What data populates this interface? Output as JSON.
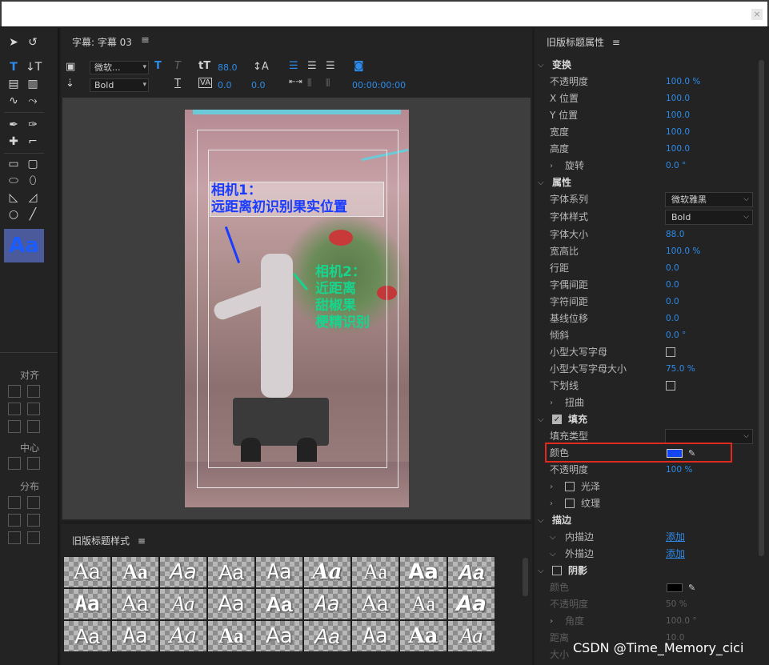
{
  "window": {
    "close_label": "×"
  },
  "editor": {
    "tab_title": "字幕: 字幕 03",
    "menu_icon": "≡",
    "font_family_short": "微软...",
    "font_style": "Bold",
    "font_size": "88.0",
    "kerning": "0.0",
    "leading": "0.0",
    "timecode": "00:00:00:00",
    "caption1_line1": "相机1：",
    "caption1_line2": "远距离初识别果实位置",
    "caption2_line1": "相机2：",
    "caption2_line2": "近距离",
    "caption2_line3": "甜椒果",
    "caption2_line4": "梗精识别"
  },
  "tools": {
    "aa_label": "Aa",
    "align_label": "对齐",
    "center_label": "中心",
    "distribute_label": "分布"
  },
  "styles_panel": {
    "title": "旧版标题样式",
    "menu_icon": "≡",
    "sample_label": "Aa"
  },
  "props": {
    "title": "旧版标题属性",
    "menu_icon": "≡",
    "transform": "变换",
    "opacity_label": "不透明度",
    "opacity_value": "100.0 %",
    "x_label": "X 位置",
    "x_value": "100.0",
    "y_label": "Y 位置",
    "y_value": "100.0",
    "width_label": "宽度",
    "width_value": "100.0",
    "height_label": "高度",
    "height_value": "100.0",
    "rotation_label": "旋转",
    "rotation_value": "0.0 °",
    "properties": "属性",
    "font_family_label": "字体系列",
    "font_family_value": "微软雅黑",
    "font_style_label": "字体样式",
    "font_style_value": "Bold",
    "font_size_label": "字体大小",
    "font_size_value": "88.0",
    "aspect_label": "宽高比",
    "aspect_value": "100.0 %",
    "leading_label": "行距",
    "leading_value": "0.0",
    "kerning_label": "字偶间距",
    "kerning_value": "0.0",
    "tracking_label": "字符间距",
    "tracking_value": "0.0",
    "baseline_label": "基线位移",
    "baseline_value": "0.0",
    "slant_label": "倾斜",
    "slant_value": "0.0 °",
    "smallcaps_label": "小型大写字母",
    "smallcaps_size_label": "小型大写字母大小",
    "smallcaps_size_value": "75.0 %",
    "underline_label": "下划线",
    "distort_label": "扭曲",
    "fill_label": "填充",
    "fill_type_label": "填充类型",
    "fill_color_label": "颜色",
    "fill_color_hex": "#1446f0",
    "fill_opacity_label": "不透明度",
    "fill_opacity_value": "100 %",
    "sheen_label": "光泽",
    "texture_label": "纹理",
    "stroke_label": "描边",
    "inner_stroke_label": "内描边",
    "outer_stroke_label": "外描边",
    "add_label": "添加",
    "shadow_label": "阴影",
    "shadow_color_label": "颜色",
    "shadow_opacity_label": "不透明度",
    "shadow_opacity_value": "50 %",
    "shadow_angle_label": "角度",
    "shadow_angle_value": "100.0 °",
    "shadow_distance_label": "距离",
    "shadow_distance_value": "10.0",
    "shadow_size_label": "大小"
  },
  "watermark": "CSDN @Time_Memory_cici",
  "colors": {
    "accent": "#2d8ceb",
    "highlight": "#e0291f",
    "caption1": "#1a3cff",
    "caption2": "#17d58e"
  }
}
